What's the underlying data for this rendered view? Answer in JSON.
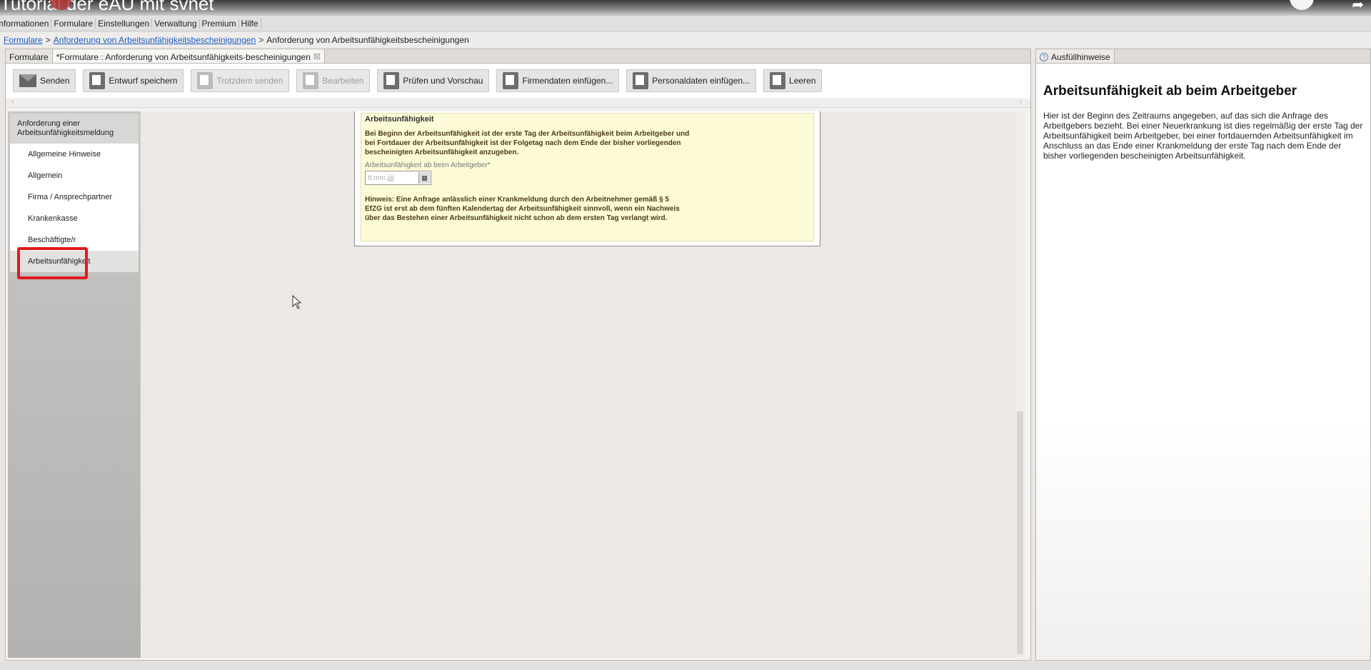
{
  "video": {
    "title": "Tutorial der eAU mit svnet"
  },
  "menu": [
    "Informationen",
    "Formulare",
    "Einstellungen",
    "Verwaltung",
    "Premium",
    "Hilfe"
  ],
  "breadcrumb": {
    "root": "Formulare",
    "link": "Anforderung von Arbeitsunfähigkeitsbescheinigungen",
    "current": "Anforderung von Arbeitsunfähigkeitsbescheinigungen"
  },
  "tabs": {
    "first": "Formulare",
    "second": "*Formulare : Anforderung von Arbeitsunfähigkeits-bescheinigungen",
    "close": "☒"
  },
  "toolbar": {
    "send": "Senden",
    "save_draft": "Entwurf speichern",
    "send_anyway": "Trotzdem senden",
    "edit": "Bearbeiten",
    "check_preview": "Prüfen und Vorschau",
    "insert_company": "Firmendaten einfügen...",
    "insert_personal": "Personaldaten einfügen...",
    "clear": "Leeren"
  },
  "nav": {
    "header": "Anforderung einer Arbeitsunfähigkeitsmeldung",
    "items": [
      "Allgemeine Hinweise",
      "Allgemein",
      "Firma / Ansprechpartner",
      "Krankenkasse",
      "Beschäftigte/r",
      "Arbeitsunfähigkeit"
    ]
  },
  "form": {
    "title": "Arbeitsunfähigkeit",
    "intro": "Bei Beginn der Arbeitsunfähigkeit ist der erste Tag der Arbeitsunfähigkeit beim Arbeitgeber und bei Fortdauer der Arbeitsunfähigkeit ist der Folgetag nach dem Ende der bisher vorliegenden bescheinigten Arbeitsunfähigkeit anzugeben.",
    "field_label": "Arbeitsunfähigkeit ab beim Arbeitgeber*",
    "field_placeholder": "tt.mm.jjjj",
    "hint": "Hinweis: Eine Anfrage anlässlich einer Krankmeldung durch den Arbeitnehmer gemäß § 5 EfZG ist erst ab dem fünften Kalendertag der Arbeitsunfähigkeit sinnvoll, wenn ein Nachweis über das Bestehen einer Arbeitsunfähigkeit nicht schon ab dem ersten Tag verlangt wird."
  },
  "help": {
    "tab": "Ausfüllhinweise",
    "title": "Arbeitsunfähigkeit ab beim Arbeitgeber",
    "text": "Hier ist der Beginn des Zeitraums angegeben, auf das sich die Anfrage des Arbeitgebers bezieht. Bei einer Neuerkrankung ist dies regelmäßig der erste Tag der Arbeitsunfähigkeit beim Arbeitgeber, bei einer fortdauernden Arbeitsunfähigkeit im Anschluss an das Ende einer Krankmeldung der erste Tag nach dem Ende der bisher vorliegenden bescheinigten Arbeitsunfähigkeit."
  },
  "colors": {
    "highlight": "#e0191e",
    "link": "#1d5bbf",
    "form_bg": "#fdfbd7"
  }
}
